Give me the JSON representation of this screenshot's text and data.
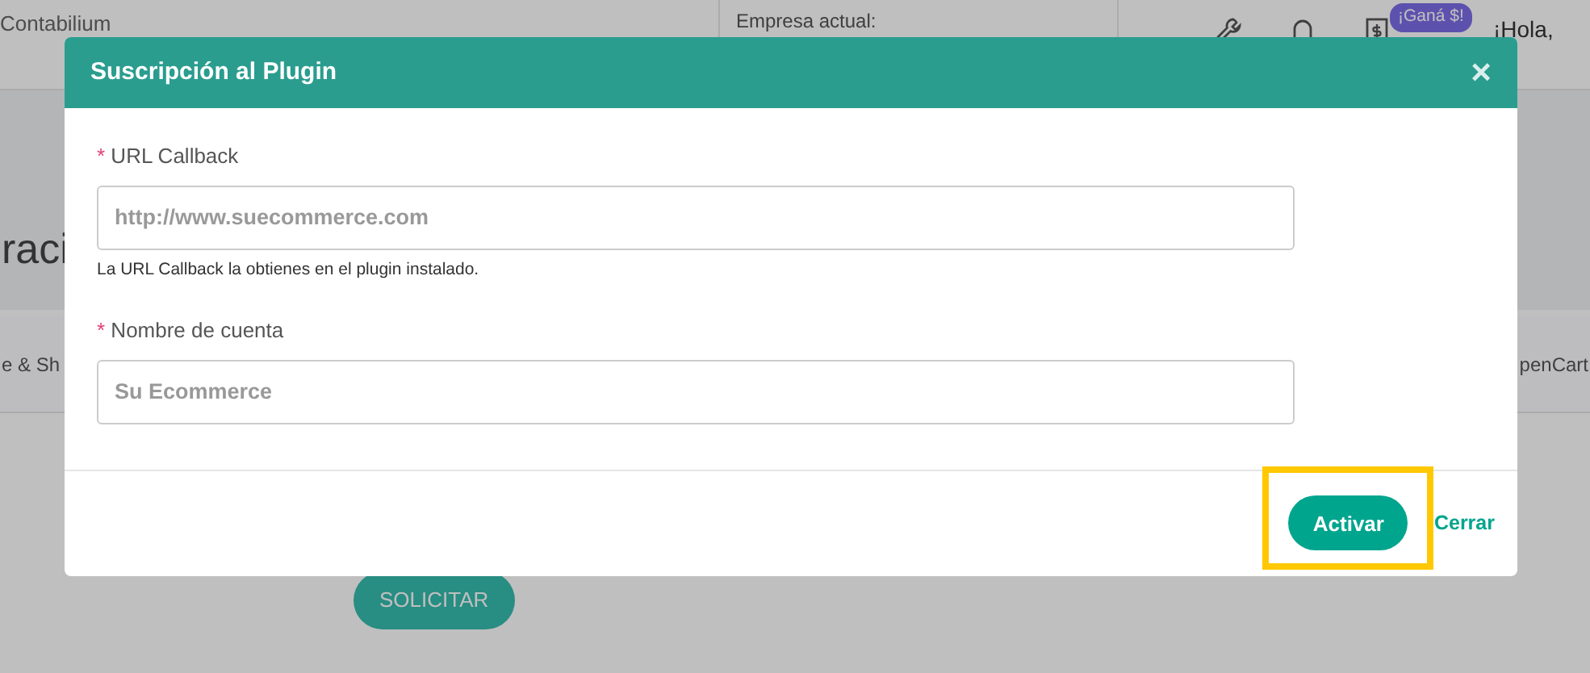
{
  "header": {
    "brand": "Contabilium",
    "company_label": "Empresa actual:",
    "promo_badge": "¡Ganá $!",
    "greeting": "¡Hola,"
  },
  "page": {
    "title_fragment": "raci",
    "tabs": [
      "e & Sh",
      "penCart"
    ],
    "request_button": "SOLICITAR"
  },
  "modal": {
    "title": "Suscripción al Plugin",
    "close": "×",
    "fields": [
      {
        "label": "URL Callback",
        "required_mark": "*",
        "placeholder": "http://www.suecommerce.com",
        "help": "La URL Callback la obtienes en el plugin instalado."
      },
      {
        "label": "Nombre de cuenta",
        "required_mark": "*",
        "placeholder": "Su Ecommerce"
      }
    ],
    "buttons": [
      {
        "label": "Activar",
        "kind": "primary",
        "highlighted": true
      },
      {
        "label": "Cerrar",
        "kind": "link",
        "highlighted": false
      }
    ]
  }
}
